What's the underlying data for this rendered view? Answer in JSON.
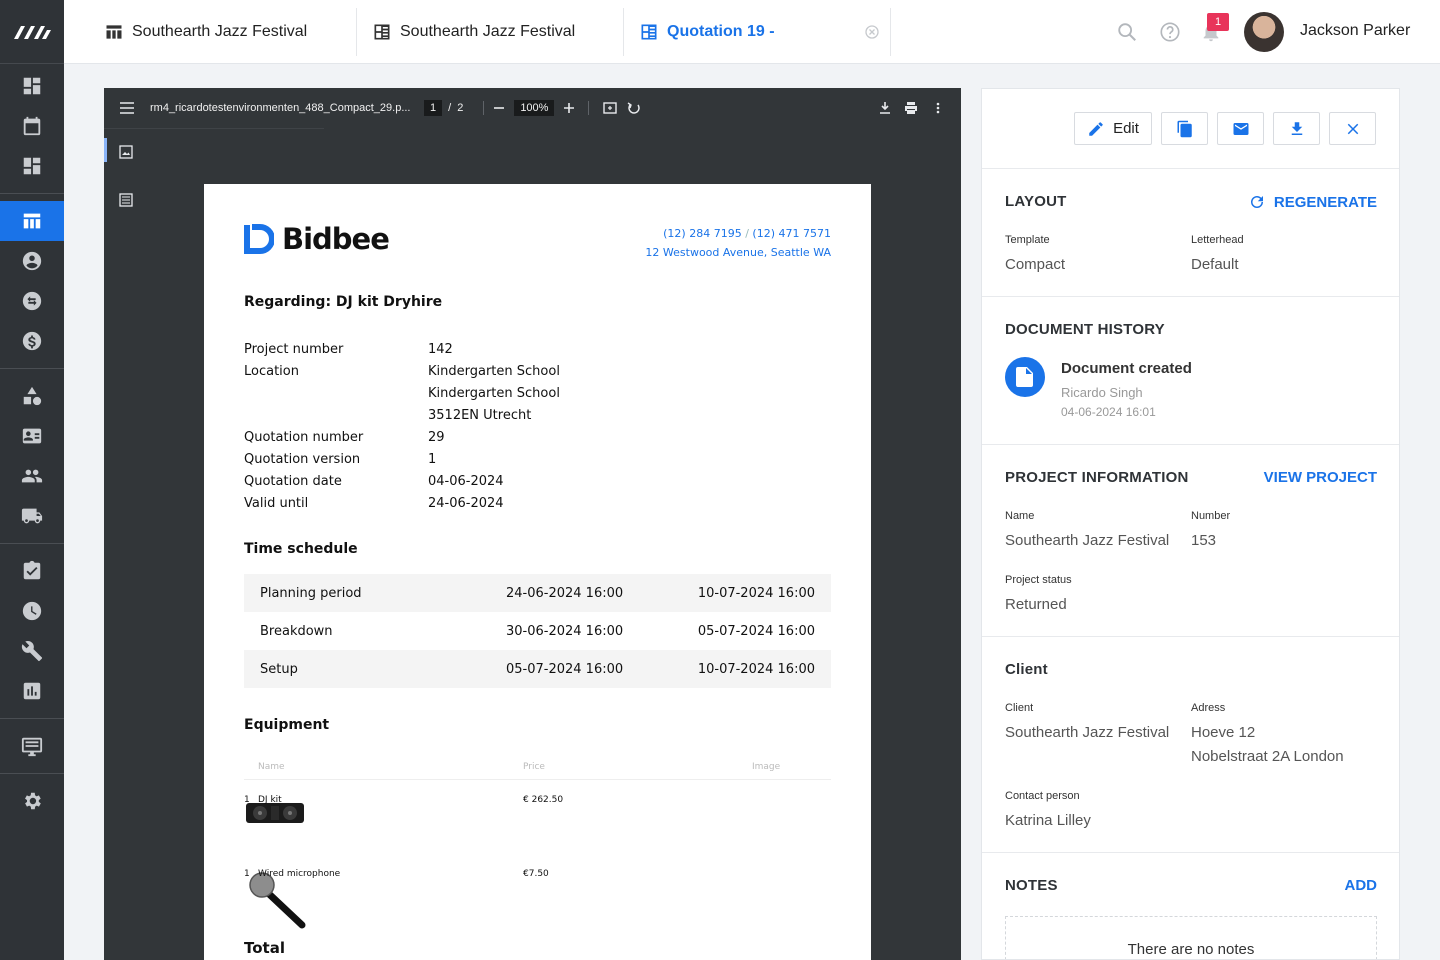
{
  "tabs": [
    {
      "label": "Southearth Jazz Festival"
    },
    {
      "label": "Southearth Jazz Festival"
    },
    {
      "label": "Quotation 19 -"
    }
  ],
  "user": {
    "name": "Jackson Parker",
    "notifications": "1"
  },
  "viewer": {
    "filename": "rm4_ricardotestenvironmenten_488_Compact_29.p...",
    "page": "1",
    "pages": "2",
    "page_sep": "/",
    "zoom": "100%"
  },
  "doc": {
    "brand": "Bidbee",
    "phone1": "(12) 284 7195",
    "phone_sep": "/",
    "phone2": "(12) 471 7571",
    "address": "12 Westwood Avenue, Seattle WA",
    "regarding": "Regarding: DJ kit Dryhire",
    "fields": [
      {
        "k": "Project number",
        "v": "142"
      },
      {
        "k": "Location",
        "v": "Kindergarten School"
      },
      {
        "k": "",
        "v": "Kindergarten School"
      },
      {
        "k": "",
        "v": "3512EN Utrecht"
      },
      {
        "k": "Quotation number",
        "v": "29"
      },
      {
        "k": "Quotation version",
        "v": "1"
      },
      {
        "k": "Quotation date",
        "v": "04-06-2024"
      },
      {
        "k": "Valid until",
        "v": "24-06-2024"
      }
    ],
    "time_title": "Time schedule",
    "schedule": [
      [
        "Planning period",
        "24-06-2024 16:00",
        "10-07-2024 16:00"
      ],
      [
        "Breakdown",
        "30-06-2024 16:00",
        "05-07-2024 16:00"
      ],
      [
        "Setup",
        "05-07-2024 16:00",
        "10-07-2024 16:00"
      ]
    ],
    "equip_title": "Equipment",
    "equip_headers": {
      "name": "Name",
      "price": "Price",
      "image": "Image"
    },
    "equipment": [
      {
        "qty": "1",
        "name": "DJ kit",
        "price": "€ 262.50"
      },
      {
        "qty": "1",
        "name": "Wired microphone",
        "price": "€7.50"
      }
    ],
    "total_title": "Total"
  },
  "panel": {
    "edit": "Edit",
    "layout": {
      "title": "LAYOUT",
      "action": "REGENERATE",
      "template_label": "Template",
      "template": "Compact",
      "letterhead_label": "Letterhead",
      "letterhead": "Default"
    },
    "history": {
      "title": "DOCUMENT HISTORY",
      "event": "Document created",
      "by": "Ricardo Singh",
      "date": "04-06-2024 16:01"
    },
    "project": {
      "title": "PROJECT INFORMATION",
      "action": "VIEW PROJECT",
      "name_label": "Name",
      "name": "Southearth Jazz Festival",
      "number_label": "Number",
      "number": "153",
      "status_label": "Project status",
      "status": "Returned"
    },
    "client": {
      "title": "Client",
      "client_label": "Client",
      "client": "Southearth Jazz Festival",
      "address_label": "Adress",
      "address1": "Hoeve 12",
      "address2": "Nobelstraat 2A London",
      "contact_label": "Contact person",
      "contact": "Katrina Lilley"
    },
    "notes": {
      "title": "NOTES",
      "action": "ADD",
      "empty": "There are no notes"
    }
  },
  "colors": {
    "accent": "#1a73e8",
    "sidebar": "#2f3337",
    "badge": "#e8345a"
  }
}
